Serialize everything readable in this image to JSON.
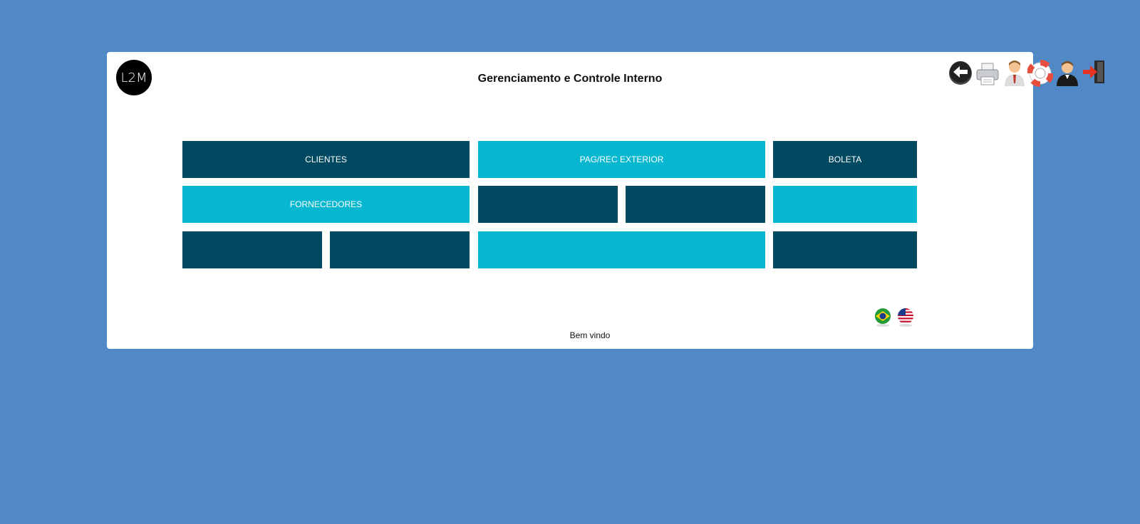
{
  "header": {
    "logo_text": "L2M",
    "title": "Gerenciamento e Controle Interno"
  },
  "toolbar": {
    "icons": [
      "back-arrow-icon",
      "printer-icon",
      "user-profile-icon",
      "help-lifebuoy-icon",
      "user-icon",
      "logout-icon"
    ]
  },
  "tiles": {
    "clientes": "CLIENTES",
    "pag_rec_exterior": "PAG/REC EXTERIOR",
    "boleta": "BOLETA",
    "fornecedores": "FORNECEDORES"
  },
  "language": {
    "options": [
      "brazil-flag-icon",
      "usa-flag-icon"
    ]
  },
  "footer": {
    "welcome": "Bem vindo"
  },
  "colors": {
    "background": "#5189c7",
    "tile_dark": "#014960",
    "tile_light": "#07b6cf"
  }
}
